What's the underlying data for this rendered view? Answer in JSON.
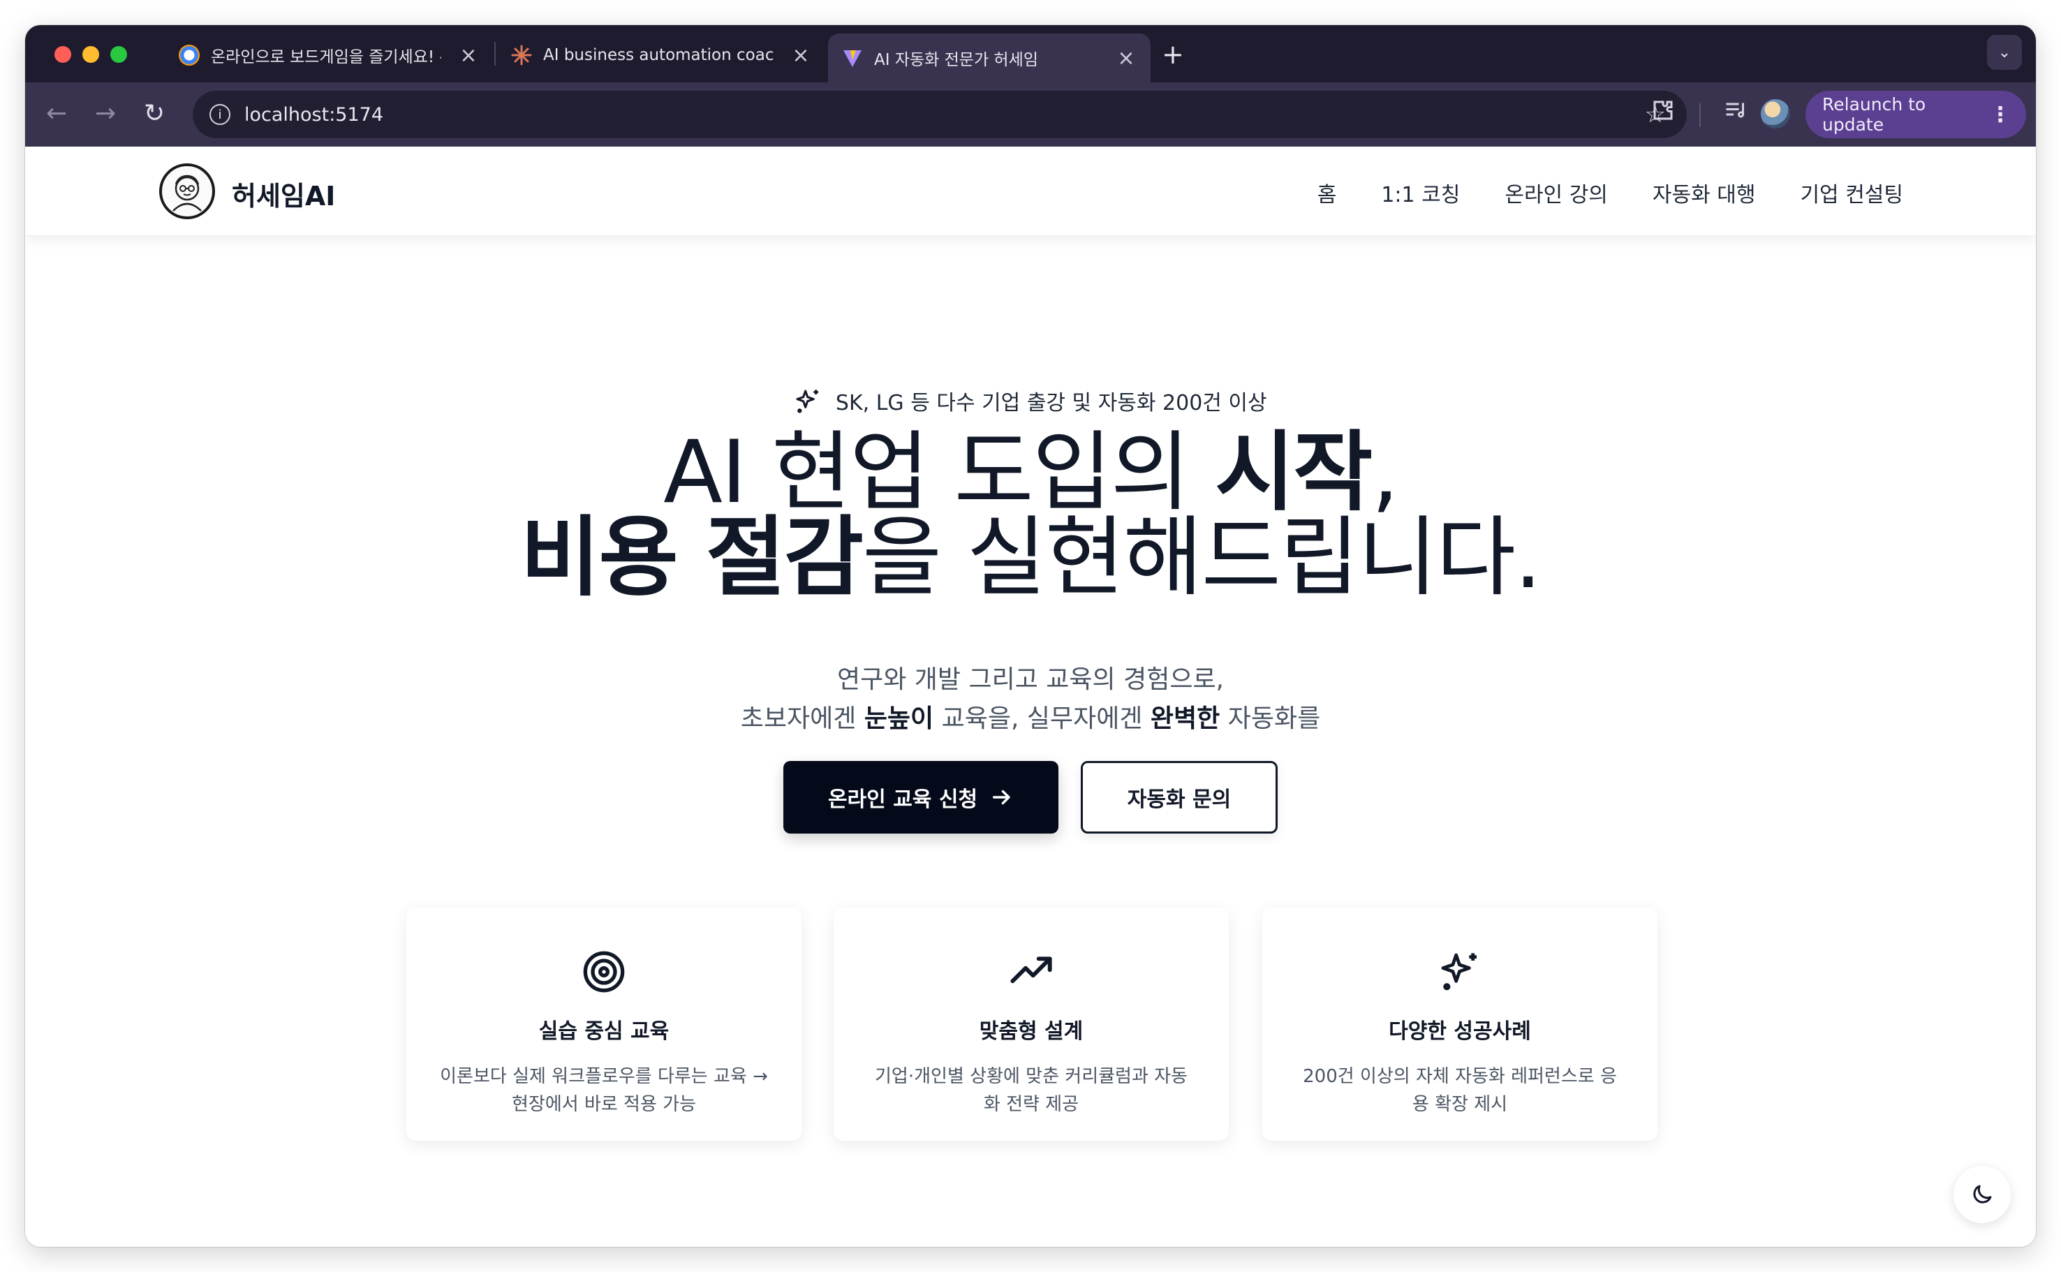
{
  "browser": {
    "tabs": [
      {
        "title": "온라인으로 보드게임을 즐기세요! -",
        "active": false
      },
      {
        "title": "AI business automation coach",
        "active": false
      },
      {
        "title": "AI 자동화 전문가 허세임",
        "active": true
      }
    ],
    "new_tab": "+",
    "url": "localhost:5174",
    "relaunch_label": "Relaunch to update"
  },
  "site": {
    "brand": "허세임AI",
    "nav": [
      "홈",
      "1:1 코칭",
      "온라인 강의",
      "자동화 대행",
      "기업 컨설팅"
    ]
  },
  "hero": {
    "badge": "SK, LG 등 다수 기업 출강 및 자동화 200건 이상",
    "title_line1_regular": "AI 현업 도입의 ",
    "title_line1_bold": "시작",
    "title_line1_end": ",",
    "title_line2_bold": "비용 절감",
    "title_line2_regular": "을 실현해드립니다.",
    "sub_line1": "연구와 개발 그리고 교육의 경험으로,",
    "sub_line2_a": "초보자에겐 ",
    "sub_line2_b": "눈높이",
    "sub_line2_c": " 교육을, 실무자에겐 ",
    "sub_line2_d": "완벽한",
    "sub_line2_e": " 자동화를",
    "primary_button": "온라인 교육 신청",
    "secondary_button": "자동화 문의"
  },
  "features": [
    {
      "icon": "target-icon",
      "title": "실습 중심 교육",
      "desc": "이론보다 실제 워크플로우를 다루는 교육 → 현장에서 바로 적용 가능"
    },
    {
      "icon": "trending-up-icon",
      "title": "맞춤형 설계",
      "desc": "기업·개인별 상황에 맞춘 커리큘럼과 자동화 전략 제공"
    },
    {
      "icon": "sparkles-icon",
      "title": "다양한 성공사례",
      "desc": "200건 이상의 자체 자동화 레퍼런스로 응용 확장 제시"
    }
  ],
  "colors": {
    "tab_bar": "#1f1b2e",
    "toolbar": "#3a3350",
    "relaunch": "#5b3f91",
    "primary_button": "#050a1a"
  }
}
